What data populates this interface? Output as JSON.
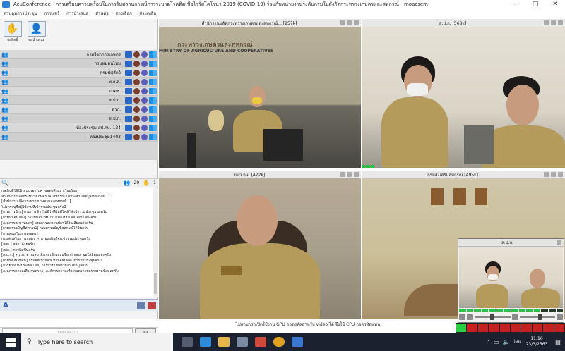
{
  "window": {
    "title": "AcuConference - การเตรียมความพร้อมในการรับสถานการณ์การระบาดโรคติดเชื้อไวรัสโคโรนา 2019 (COVID-19) ร่วมกับหน่วยงานระดับกรมในสังกัดกระทรวงเกษตรและสหกรณ์ - moacsem",
    "minimize": "—",
    "maximize": "□",
    "close": "✕"
  },
  "menu": [
    "ควบคุมการประชุม",
    "การแชร์",
    "การนำเสนอ",
    "ส่วนตัว",
    "ทางเลือก",
    "ช่วยเหลือ"
  ],
  "hand_toolbar": {
    "raise_label": "ขอสิทธิ์",
    "present_label": "ขอนำเสนอ"
  },
  "sites": [
    "กรมวิชาการเกษตร",
    "กรมหม่อนไหม",
    "กรมปศุสัตว์",
    "พ.ก.ส.",
    "มกอช.",
    "ส.ป.ก.",
    "สวก.",
    "ส.ป.ก.",
    "ห้องประชุม สป.กษ. 134",
    "ห้องประชุม1403"
  ],
  "list_status": {
    "count": "29",
    "hand_count": "1"
  },
  "chat_lines": [
    "กษ.ยินดีให้ใช้ระบบรองรับคำขอต่อสัญญาเรียบร้อย",
    "สำนักงานปลัดกระทรวงเกษตรและสหกรณ์ ได้ประสานข้อมูลเรียบร้อย...]",
    "[สำนักงานปลัดกระทรวงเกษตรและสหกรณ์...]",
    "โปรดระบุชื่อผู้ใช้งานที่เข้าร่วมประชุมครั้งนี้",
    "[กรมการข้าว] กรมการข้าวไม่มีไฟล์ไม่มีไฟล์ ได้เข้าร่วมประชุมนะครับ",
    "[กรมหม่อนไหม] กรมหม่อนไหมไม่มีไฟล์ไม่มีไฟล์ได้ยินเสียงครับ",
    "[องค์การสะพานปลา] องค์การสะพานปลาได้ยินเสียงแล้วครับ",
    "[กรมตรวจบัญชีสหกรณ์] กรมตรวจบัญชีสหกรณ์ได้ยินครับ",
    "[กรมส่งเสริมการเกษตร]",
    "กรมส่งเสริมการเกษตร ท่านรองอธิบดีจะเข้าร่วมประชุมครับ",
    "[สสก.] สสก. ด้วยครับ",
    "[สสก.] ภาพไม่ขึ้นครับ",
    "[ส.ป.ก.] ส.ป.ก. ท่านเลขาธิการ เข้าระบบชื่อ vinaroj ขอให้มีมุมมองครับ",
    "[กรมพัฒนาที่ดิน] กรมพัฒนาที่ดิน ท่านอธิบดีจะเข้าร่วมประชุมครับ",
    "[การยางแห่งประเทศไทย] การยางฯ ขอรายงานข้อมูลครับ",
    "[องค์การตลาดเพื่อเกษตรกร] องค์การตลาดเพื่อเกษตรกรขอรายงานข้อมูลครับ"
  ],
  "chat_input": {
    "placeholder": "พิมพ์ข้อความ",
    "send": "ส่ง"
  },
  "videos": [
    {
      "title": "สำนักงานปลัดกระทรวงเกษตรและสหกรณ์... [257k]",
      "sign_text": "กระทรวงเกษตรและสหกรณ์",
      "sign_en": "MINISTRY OF AGRICULTURE AND COOPERATIVES"
    },
    {
      "title": "ส.ป.ก. [568k]"
    },
    {
      "title": "ขมว.กษ. [472k]"
    },
    {
      "title": "กรมส่งเสริมสหกรณ์ [495k]"
    }
  ],
  "overlay": {
    "title": "ส.ป.ก."
  },
  "status_message": "ไม่สามารถเปิดใช้งาน GPU ถอดรหัสสำหรับ video ได้ จึงใช้ CPU ถอดรหัสแทน",
  "taskbar": {
    "search_placeholder": "Type here to search",
    "language": "ไทย",
    "time": "11:16",
    "date": "23/3/2563"
  },
  "colors": {
    "accent": "#2a7fd4",
    "list_bg": "#d6d6d6",
    "meter_green": "#22c040",
    "meter_red": "#c82020",
    "taskbar": "#1c2130"
  }
}
